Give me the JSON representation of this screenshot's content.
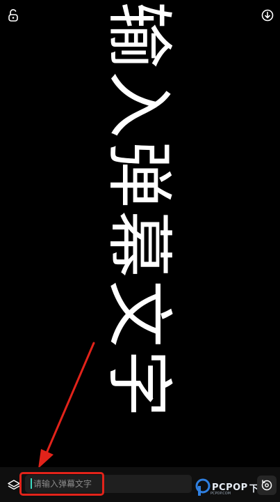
{
  "toolbar": {
    "lock_icon": "lock-icon",
    "download_icon": "download-icon"
  },
  "danmaku": {
    "characters": [
      "输",
      "入",
      "弹",
      "幕",
      "文",
      "字"
    ],
    "color": "#ffffff"
  },
  "bottom_bar": {
    "layers_icon": "layers-icon",
    "input": {
      "value": "",
      "placeholder": "请输入弹幕文字"
    },
    "camera_switch_icon": "camera-switch-icon"
  },
  "watermark": {
    "text": "PCPOP",
    "glyph": "下",
    "sub": "PCPOP.COM"
  },
  "annotation": {
    "color": "#e2231a"
  }
}
